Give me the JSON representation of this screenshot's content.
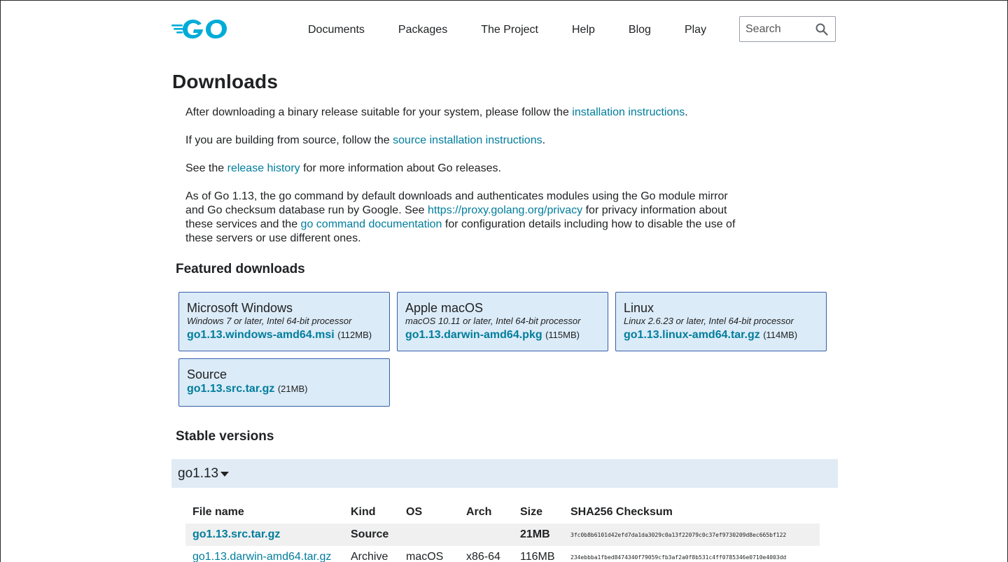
{
  "header": {
    "nav": [
      "Documents",
      "Packages",
      "The Project",
      "Help",
      "Blog",
      "Play"
    ],
    "search_placeholder": "Search"
  },
  "page_title": "Downloads",
  "intro": {
    "p1_before": "After downloading a binary release suitable for your system, please follow the ",
    "p1_link": "installation instructions",
    "p1_after": ".",
    "p2_before": "If you are building from source, follow the ",
    "p2_link": "source installation instructions",
    "p2_after": ".",
    "p3_before": "See the ",
    "p3_link": "release history",
    "p3_after": " for more information about Go releases.",
    "p4_a": "As of Go 1.13, the go command by default downloads and authenticates modules using the Go module mirror and Go checksum database run by Google. See ",
    "p4_link1": "https://proxy.golang.org/privacy",
    "p4_b": " for privacy information about these services and the ",
    "p4_link2": "go command documentation",
    "p4_c": " for configuration details including how to disable the use of these servers or use different ones."
  },
  "featured": {
    "heading": "Featured downloads",
    "cards": [
      {
        "title": "Microsoft Windows",
        "desc": "Windows 7 or later, Intel 64-bit processor",
        "file": "go1.13.windows-amd64.msi",
        "size": "(112MB)"
      },
      {
        "title": "Apple macOS",
        "desc": "macOS 10.11 or later, Intel 64-bit processor",
        "file": "go1.13.darwin-amd64.pkg",
        "size": "(115MB)"
      },
      {
        "title": "Linux",
        "desc": "Linux 2.6.23 or later, Intel 64-bit processor",
        "file": "go1.13.linux-amd64.tar.gz",
        "size": "(114MB)"
      },
      {
        "title": "Source",
        "desc": "",
        "file": "go1.13.src.tar.gz",
        "size": "(21MB)"
      }
    ]
  },
  "stable": {
    "heading": "Stable versions",
    "version": "go1.13",
    "columns": [
      "File name",
      "Kind",
      "OS",
      "Arch",
      "Size",
      "SHA256 Checksum"
    ],
    "rows": [
      {
        "file": "go1.13.src.tar.gz",
        "kind": "Source",
        "os": "",
        "arch": "",
        "size": "21MB",
        "sha": "3fc0b8b6101d42efd7da1da3029c0a13f22079c0c37ef9730209d8ec665bf122"
      },
      {
        "file": "go1.13.darwin-amd64.tar.gz",
        "kind": "Archive",
        "os": "macOS",
        "arch": "x86-64",
        "size": "116MB",
        "sha": "234ebbba1fbed8474340f79059cfb3af2a0f8b531c4ff0785346e0710e4003dd"
      }
    ]
  }
}
